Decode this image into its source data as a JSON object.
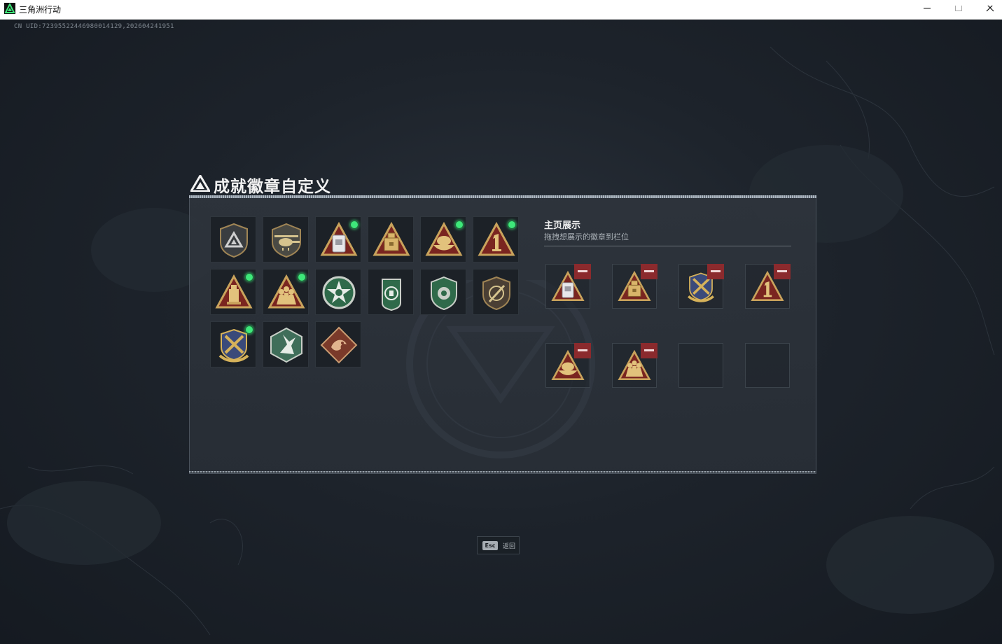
{
  "window": {
    "title": "三角洲行动",
    "min_icon": "minimize-icon",
    "max_icon": "maximize-icon",
    "close_icon": "close-icon"
  },
  "uid_text": "CN UID:72395522446980014129,202604241951",
  "dialog": {
    "title": "成就徽章自定义",
    "showcase": {
      "title": "主页展示",
      "subtitle": "拖拽想展示的徽章到栏位"
    }
  },
  "badges": [
    {
      "icon": "delta-shield-badge-icon",
      "new": false
    },
    {
      "icon": "helicopter-shield-badge-icon",
      "new": false
    },
    {
      "icon": "silver-jar-triangle-badge-icon",
      "new": true
    },
    {
      "icon": "gold-crate-triangle-badge-icon",
      "new": false
    },
    {
      "icon": "gold-boat-triangle-badge-icon",
      "new": true
    },
    {
      "icon": "number-one-triangle-badge-icon",
      "new": true
    },
    {
      "icon": "gold-pillar-triangle-badge-icon",
      "new": false
    },
    {
      "icon": "soldiers-triangle-badge-icon",
      "new": true
    },
    {
      "icon": "green-star-medal-badge-icon",
      "new": false
    },
    {
      "icon": "green-dog-tag-badge-icon",
      "new": false
    },
    {
      "icon": "green-shield-badge-icon",
      "new": false
    },
    {
      "icon": "bronze-crossed-shield-badge-icon",
      "new": false
    },
    {
      "icon": "blue-gold-crest-badge-icon",
      "new": true
    },
    {
      "icon": "green-hex-rabbit-badge-icon",
      "new": false
    },
    {
      "icon": "bronze-dragon-diamond-badge-icon",
      "new": false
    }
  ],
  "showcase_slots": [
    {
      "icon": "silver-jar-triangle-badge-icon",
      "filled": true
    },
    {
      "icon": "gold-crate-triangle-badge-icon",
      "filled": true
    },
    {
      "icon": "blue-gold-crest-badge-icon",
      "filled": true
    },
    {
      "icon": "number-one-triangle-badge-icon",
      "filled": true
    },
    {
      "icon": "gold-boat-triangle-badge-icon",
      "filled": true
    },
    {
      "icon": "soldiers-triangle-badge-icon",
      "filled": true
    },
    {
      "icon": "",
      "filled": false
    },
    {
      "icon": "",
      "filled": false
    }
  ],
  "esc_hint": {
    "key": "Esc",
    "label": "返回"
  },
  "colors": {
    "accent_green": "#3ee87a",
    "remove_red": "#8b2a2d",
    "gold": "#c9a35c"
  }
}
